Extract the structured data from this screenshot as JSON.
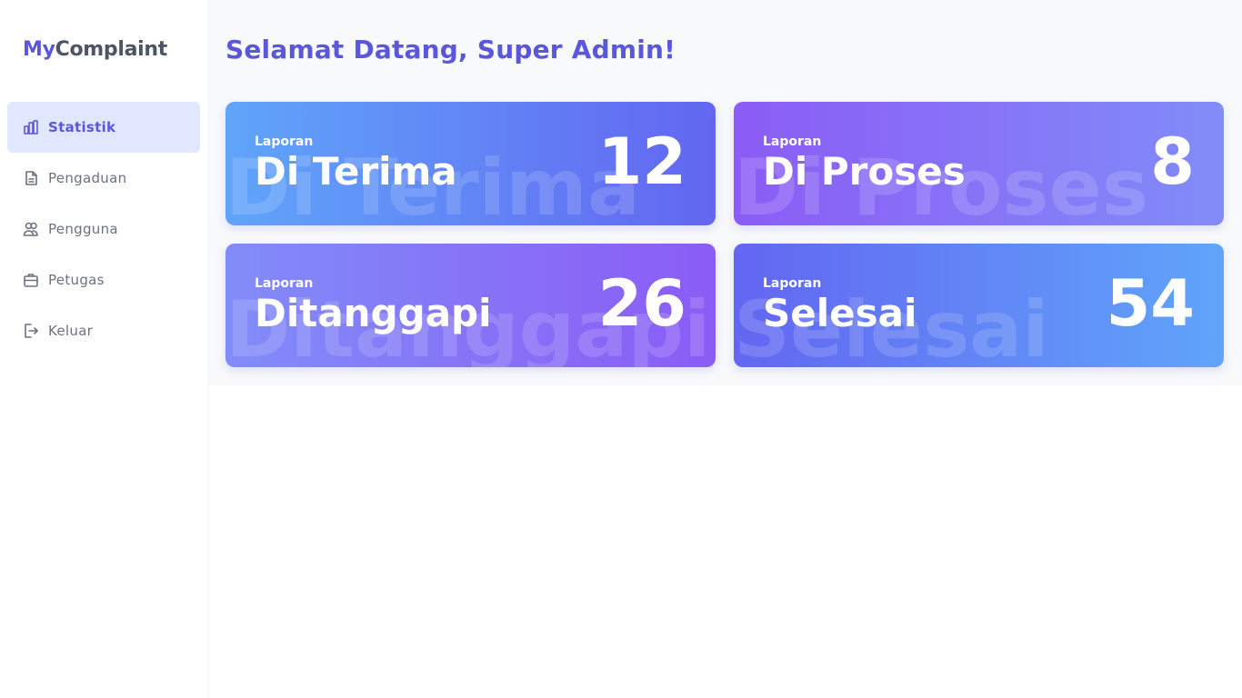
{
  "brand": {
    "prefix": "My",
    "suffix": "Complaint"
  },
  "sidebar": {
    "items": [
      {
        "label": "Statistik",
        "icon": "bar-chart-icon",
        "active": true
      },
      {
        "label": "Pengaduan",
        "icon": "document-icon",
        "active": false
      },
      {
        "label": "Pengguna",
        "icon": "users-icon",
        "active": false
      },
      {
        "label": "Petugas",
        "icon": "briefcase-icon",
        "active": false
      },
      {
        "label": "Keluar",
        "icon": "logout-icon",
        "active": false
      }
    ]
  },
  "main": {
    "welcome": "Selamat Datang, Super Admin!",
    "cards": [
      {
        "small": "Laporan",
        "title": "Di Terima",
        "count": "12"
      },
      {
        "small": "Laporan",
        "title": "Di Proses",
        "count": "8"
      },
      {
        "small": "Laporan",
        "title": "Ditanggapi",
        "count": "26"
      },
      {
        "small": "Laporan",
        "title": "Selesai",
        "count": "54"
      }
    ]
  },
  "colors": {
    "accent": "#5b57d9",
    "active_bg": "#e0e7ff",
    "blue": "#60a5fa",
    "indigo": "#6366f1",
    "violet": "#8b5cf6"
  }
}
